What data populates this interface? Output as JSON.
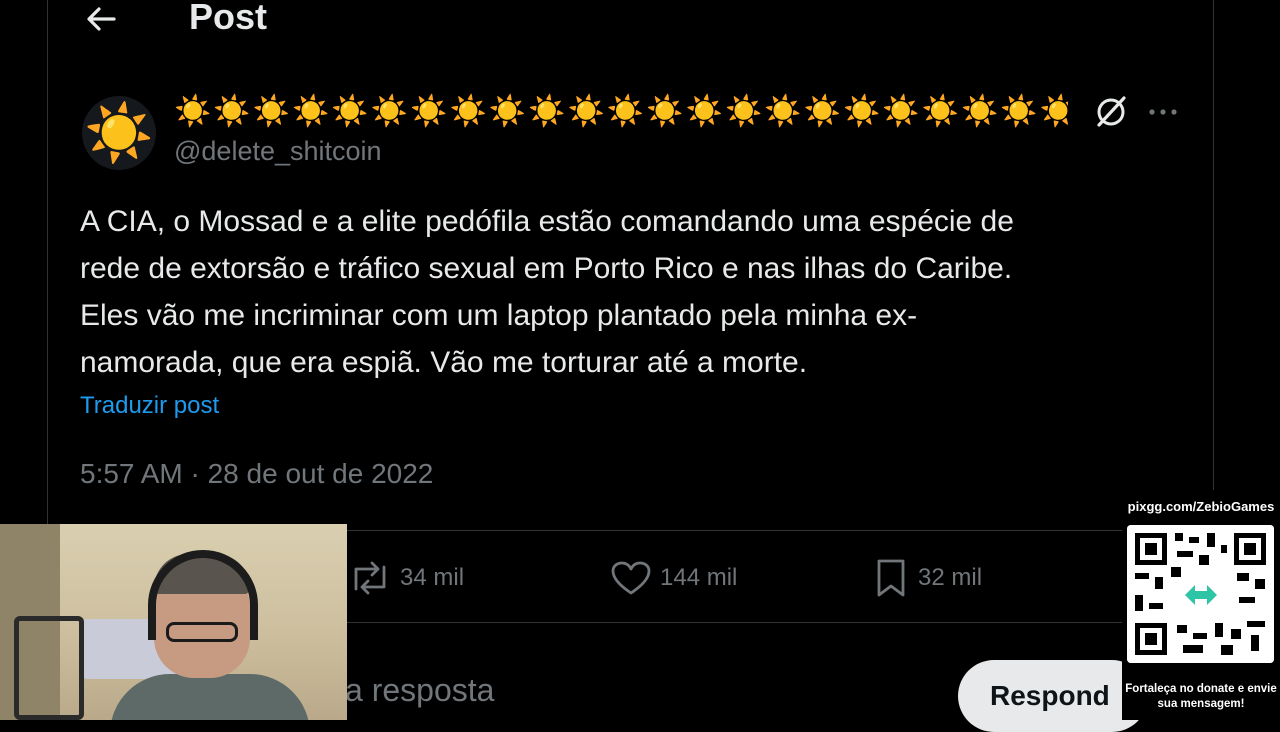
{
  "header": {
    "title": "Post"
  },
  "post": {
    "avatar_glyph": "☀️",
    "display_name": "☀️☀️☀️☀️☀️☀️☀️☀️☀️☀️☀️☀️☀️☀️☀️☀️☀️☀️☀️☀️☀️☀️☀️...",
    "handle": "@delete_shitcoin",
    "text_lines": [
      "A CIA, o Mossad e a elite pedófila estão comandando uma espécie de",
      "rede de extorsão e tráfico sexual em Porto Rico e nas ilhas do Caribe.",
      "Eles vão me incriminar com um laptop plantado pela minha ex-",
      "namorada, que era espiã. Vão me torturar até a morte."
    ],
    "translate_label": "Traduzir post",
    "timestamp": "5:57 AM · 28 de out de 2022"
  },
  "actions": {
    "reposts": "34 mil",
    "likes": "144 mil",
    "bookmarks": "32 mil"
  },
  "reply": {
    "placeholder": "a resposta",
    "button_label": "Respond"
  },
  "donate": {
    "url": "pixgg.com/ZebioGames",
    "message": "Fortaleça no donate e envie sua mensagem!"
  },
  "colors": {
    "background": "#000000",
    "text": "#e7e9ea",
    "muted": "#71767b",
    "link": "#1d9bf0",
    "divider": "#2f3336"
  },
  "icons": [
    "back-arrow-icon",
    "grok-icon",
    "more-icon",
    "repost-icon",
    "heart-icon",
    "bookmark-icon",
    "qr-code-icon"
  ]
}
